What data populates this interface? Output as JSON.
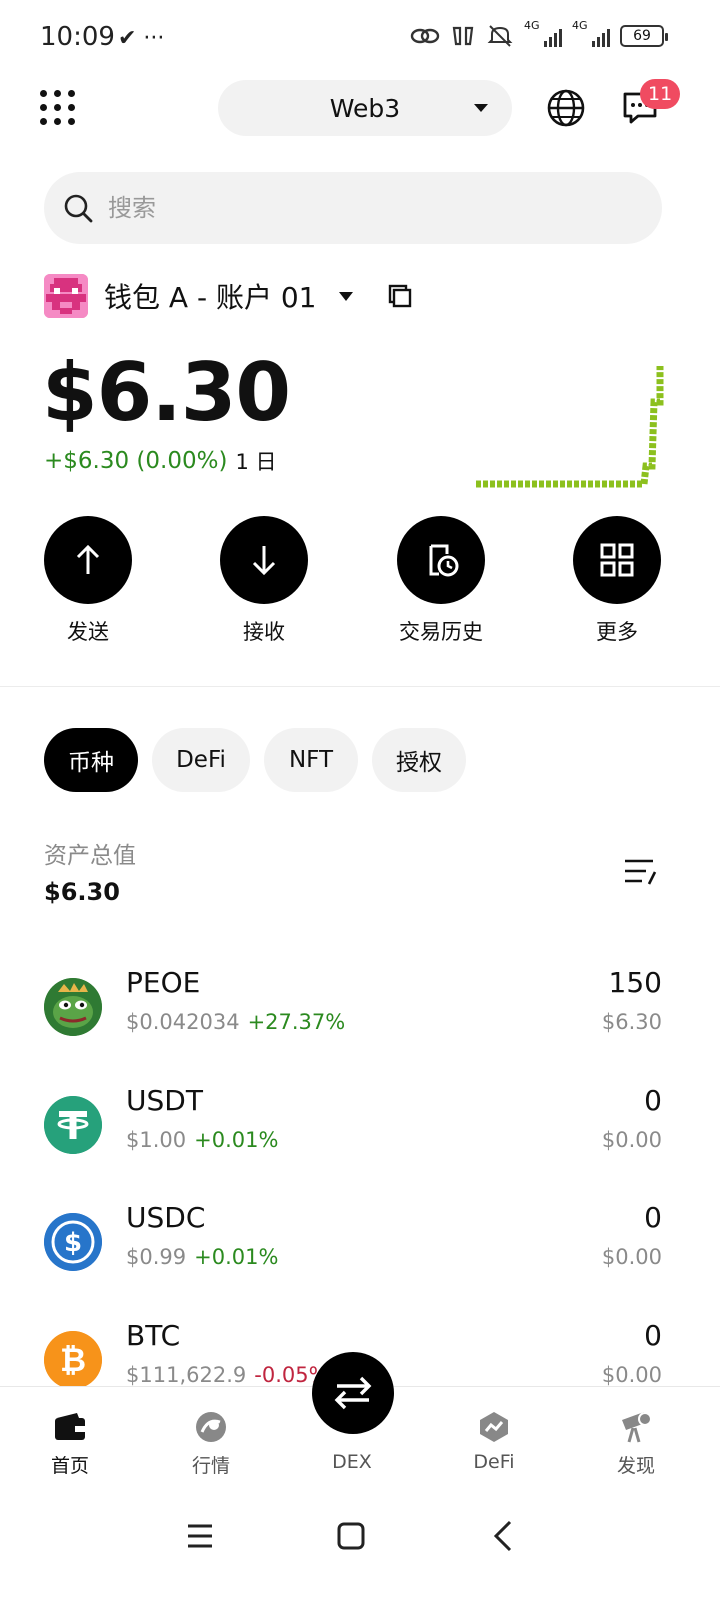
{
  "status_bar": {
    "time": "10:09",
    "left_icons": "✔ ···",
    "battery": "69",
    "network_1": "4G",
    "network_2": "4G"
  },
  "header": {
    "network_selector": "Web3",
    "notification_count": "11"
  },
  "search": {
    "placeholder": "搜索"
  },
  "wallet": {
    "name": "钱包 A - 账户 01",
    "balance": "$6.30",
    "change": "+$6.30 (0.00%)",
    "period": "1 日"
  },
  "actions": [
    {
      "label": "发送",
      "icon": "arrow-up-icon"
    },
    {
      "label": "接收",
      "icon": "arrow-down-icon"
    },
    {
      "label": "交易历史",
      "icon": "history-icon"
    },
    {
      "label": "更多",
      "icon": "grid-icon"
    }
  ],
  "tabs": [
    {
      "label": "币种",
      "active": true
    },
    {
      "label": "DeFi",
      "active": false
    },
    {
      "label": "NFT",
      "active": false
    },
    {
      "label": "授权",
      "active": false
    }
  ],
  "total": {
    "label": "资产总值",
    "value": "$6.30"
  },
  "tokens": [
    {
      "symbol": "PEOE",
      "price": "$0.042034",
      "change": "+27.37%",
      "direction": "up",
      "amount": "150",
      "value": "$6.30",
      "icon": "pepe-token-icon",
      "color": "#3e8d3e"
    },
    {
      "symbol": "USDT",
      "price": "$1.00",
      "change": "+0.01%",
      "direction": "up",
      "amount": "0",
      "value": "$0.00",
      "icon": "tether-token-icon",
      "color": "#26a17b"
    },
    {
      "symbol": "USDC",
      "price": "$0.99",
      "change": "+0.01%",
      "direction": "up",
      "amount": "0",
      "value": "$0.00",
      "icon": "usdc-token-icon",
      "color": "#2775ca"
    },
    {
      "symbol": "BTC",
      "price": "$111,622.9",
      "change": "-0.05%",
      "direction": "down",
      "amount": "0",
      "value": "$0.00",
      "icon": "bitcoin-token-icon",
      "color": "#f7931a"
    }
  ],
  "bottom_nav": [
    {
      "label": "首页",
      "icon": "wallet-icon",
      "active": true
    },
    {
      "label": "行情",
      "icon": "market-icon",
      "active": false
    },
    {
      "label": "DEX",
      "icon": "swap-icon",
      "active": false
    },
    {
      "label": "DeFi",
      "icon": "defi-icon",
      "active": false
    },
    {
      "label": "发现",
      "icon": "discover-icon",
      "active": false
    }
  ],
  "colors": {
    "positive": "#2b8a1f",
    "negative": "#c0253f",
    "badge": "#f04b61",
    "sparkline": "#8cc01e"
  }
}
